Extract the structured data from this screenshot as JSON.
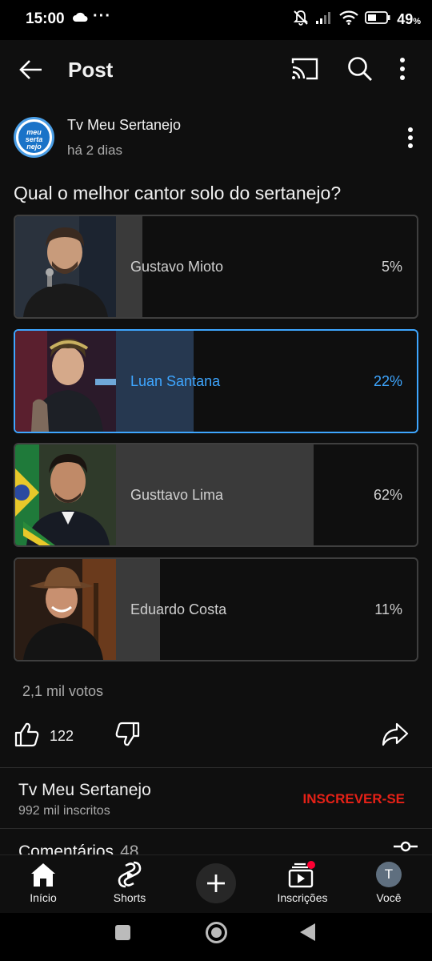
{
  "status_bar": {
    "time": "15:00",
    "extra": "···",
    "battery_pct": "49",
    "battery_unit": "%"
  },
  "app_bar": {
    "title": "Post"
  },
  "post": {
    "channel_name": "Tv Meu Sertanejo",
    "avatar_text": "meu serta nejo",
    "time_ago": "há 2 dias",
    "question": "Qual o melhor cantor solo do sertanejo?",
    "options": [
      {
        "label": "Gustavo Mioto",
        "percent_text": "5%",
        "percent": 5,
        "selected": false
      },
      {
        "label": "Luan Santana",
        "percent_text": "22%",
        "percent": 22,
        "selected": true
      },
      {
        "label": "Gusttavo Lima",
        "percent_text": "62%",
        "percent": 62,
        "selected": false
      },
      {
        "label": "Eduardo Costa",
        "percent_text": "11%",
        "percent": 11,
        "selected": false
      }
    ],
    "votes": "2,1 mil votos",
    "like_count": "122"
  },
  "channel_section": {
    "name": "Tv Meu Sertanejo",
    "subscribers": "992 mil inscritos",
    "subscribe_label": "INSCREVER-SE"
  },
  "comments": {
    "label": "Comentários",
    "count": "48"
  },
  "bottom_nav": {
    "home": "Início",
    "shorts": "Shorts",
    "subscriptions": "Inscrições",
    "you": "Você",
    "you_initial": "T"
  },
  "colors": {
    "background": "#0f0f0f",
    "accent_blue": "#3ea6ff",
    "subscribe_red": "#e62117"
  }
}
